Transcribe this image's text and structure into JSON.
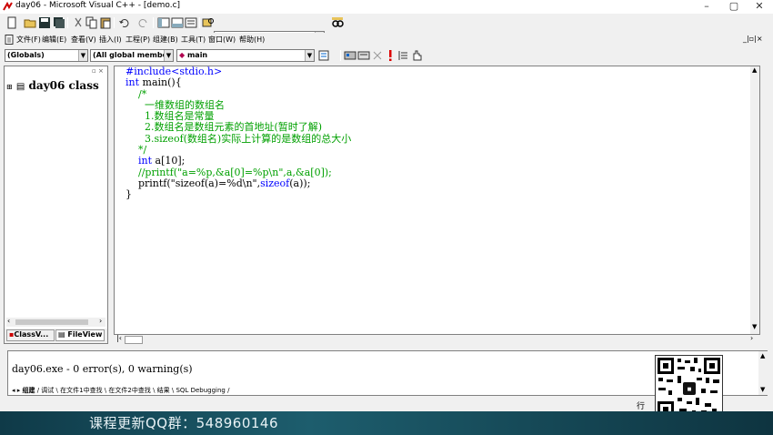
{
  "window": {
    "title": "day06 - Microsoft Visual C++ - [demo.c]",
    "minimize": "–",
    "maximize": "▢",
    "close": "✕"
  },
  "menu": {
    "items": [
      "文件(F)",
      "编辑(E)",
      "查看(V)",
      "插入(I)",
      "工程(P)",
      "组建(B)",
      "工具(T)",
      "窗口(W)",
      "帮助(H)"
    ],
    "mdi_controls": "_|▫|×"
  },
  "wizardbar": {
    "class_combo": "(Globals)",
    "filter_combo": "(All global members",
    "member_combo": "main"
  },
  "workspace": {
    "tree_item": "day06 class",
    "tabs": [
      "ClassV...",
      "FileView"
    ]
  },
  "editor": {
    "lines": [
      [
        {
          "t": "#include<stdio.h>",
          "c": "kw"
        }
      ],
      [
        {
          "t": "int",
          "c": "kw"
        },
        {
          "t": " main(){",
          "c": "plain"
        }
      ],
      [
        {
          "t": "    /*",
          "c": "cm"
        }
      ],
      [
        {
          "t": "      一维数组的数组名",
          "c": "cm"
        }
      ],
      [
        {
          "t": "      1.数组名是常量",
          "c": "cm"
        }
      ],
      [
        {
          "t": "      2.数组名是数组元素的首地址(暂时了解)",
          "c": "cm"
        }
      ],
      [
        {
          "t": "      3.sizeof(数组名)实际上计算的是数组的总大小",
          "c": "cm"
        }
      ],
      [
        {
          "t": "    */",
          "c": "cm"
        }
      ],
      [
        {
          "t": "    ",
          "c": "plain"
        },
        {
          "t": "int",
          "c": "kw"
        },
        {
          "t": " a[10];",
          "c": "plain"
        }
      ],
      [
        {
          "t": "    //printf(\"a=%p,&a[0]=%p\\n\",a,&a[0]);",
          "c": "cm"
        }
      ],
      [
        {
          "t": "    printf(\"sizeof(a)=%d\\n\",",
          "c": "plain"
        },
        {
          "t": "sizeof",
          "c": "kw"
        },
        {
          "t": "(a));",
          "c": "plain"
        }
      ],
      [
        {
          "t": "}",
          "c": "plain"
        }
      ]
    ]
  },
  "output": {
    "message": "day06.exe - 0 error(s), 0 warning(s)",
    "tabs": [
      "组建",
      "调试",
      "在文件1中查找",
      "在文件2中查找",
      "结果",
      "SQL Debugging"
    ]
  },
  "statusbar": {
    "line_label": "行"
  },
  "banner": {
    "text": "课程更新QQ群：548960146"
  },
  "colors": {
    "keyword": "#0000ff",
    "comment": "#00a000",
    "banner": "#1d5d6d"
  }
}
